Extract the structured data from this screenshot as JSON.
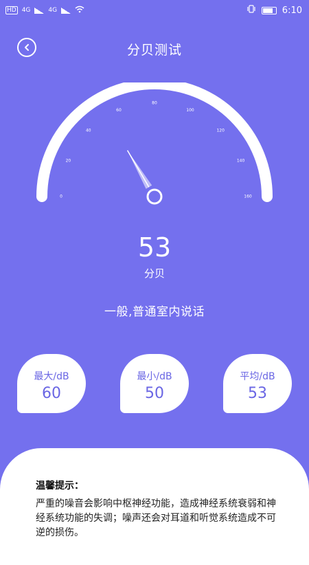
{
  "status_bar": {
    "left": [
      "HD",
      "4G",
      "4G"
    ],
    "time": "6:10"
  },
  "header": {
    "title": "分贝测试",
    "back_icon": "chevron-left-icon"
  },
  "gauge": {
    "scale_labels": [
      "0",
      "20",
      "40",
      "60",
      "80",
      "100",
      "120",
      "140",
      "160"
    ],
    "needle_value": 53,
    "max": 160
  },
  "reading": {
    "value": "53",
    "unit": "分贝",
    "description": "一般,普通室内说话"
  },
  "stats": [
    {
      "label": "最大/dB",
      "value": "60"
    },
    {
      "label": "最小/dB",
      "value": "50"
    },
    {
      "label": "平均/dB",
      "value": "53"
    }
  ],
  "tips": {
    "title": "温馨提示：",
    "body": "严重的噪音会影响中枢神经功能，造成神经系统衰弱和神经系统功能的失调；噪声还会对耳道和听觉系统造成不可逆的损伤。"
  },
  "colors": {
    "background": "#7470EE",
    "accent": "#6A66E4",
    "card": "#FFFFFF"
  }
}
